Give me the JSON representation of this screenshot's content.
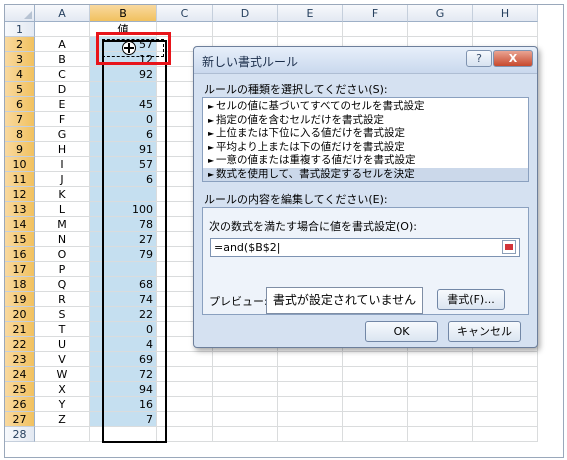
{
  "sheet": {
    "columns": [
      "A",
      "B",
      "C",
      "D",
      "E",
      "F",
      "G",
      "H"
    ],
    "selected_column": "B",
    "rows": [
      {
        "n": "1",
        "a": "",
        "b": "値"
      },
      {
        "n": "2",
        "a": "A",
        "b": "57"
      },
      {
        "n": "3",
        "a": "B",
        "b": "12"
      },
      {
        "n": "4",
        "a": "C",
        "b": "92"
      },
      {
        "n": "5",
        "a": "D",
        "b": ""
      },
      {
        "n": "6",
        "a": "E",
        "b": "45"
      },
      {
        "n": "7",
        "a": "F",
        "b": "0"
      },
      {
        "n": "8",
        "a": "G",
        "b": "6"
      },
      {
        "n": "9",
        "a": "H",
        "b": "91"
      },
      {
        "n": "10",
        "a": "I",
        "b": "57"
      },
      {
        "n": "11",
        "a": "J",
        "b": "6"
      },
      {
        "n": "12",
        "a": "K",
        "b": ""
      },
      {
        "n": "13",
        "a": "L",
        "b": "100"
      },
      {
        "n": "14",
        "a": "M",
        "b": "78"
      },
      {
        "n": "15",
        "a": "N",
        "b": "27"
      },
      {
        "n": "16",
        "a": "O",
        "b": "79"
      },
      {
        "n": "17",
        "a": "P",
        "b": ""
      },
      {
        "n": "18",
        "a": "Q",
        "b": "68"
      },
      {
        "n": "19",
        "a": "R",
        "b": "74"
      },
      {
        "n": "20",
        "a": "S",
        "b": "22"
      },
      {
        "n": "21",
        "a": "T",
        "b": "0"
      },
      {
        "n": "22",
        "a": "U",
        "b": "4"
      },
      {
        "n": "23",
        "a": "V",
        "b": "69"
      },
      {
        "n": "24",
        "a": "W",
        "b": "72"
      },
      {
        "n": "25",
        "a": "X",
        "b": "94"
      },
      {
        "n": "26",
        "a": "Y",
        "b": "16"
      },
      {
        "n": "27",
        "a": "Z",
        "b": "7"
      },
      {
        "n": "28",
        "a": "",
        "b": ""
      }
    ]
  },
  "dialog": {
    "title": "新しい書式ルール",
    "help_label": "?",
    "close_label": "X",
    "rule_type_label": "ルールの種類を選択してください(S):",
    "rule_types": [
      "セルの値に基づいてすべてのセルを書式設定",
      "指定の値を含むセルだけを書式設定",
      "上位または下位に入る値だけを書式設定",
      "平均より上または下の値だけを書式設定",
      "一意の値または重複する値だけを書式設定",
      "数式を使用して、書式設定するセルを決定"
    ],
    "selected_rule_index": 5,
    "edit_label": "ルールの内容を編集してください(E):",
    "formula_label": "次の数式を満たす場合に値を書式設定(O):",
    "formula_value": "=and($B$2|",
    "preview_label": "プレビュー:",
    "preview_text": "書式が設定されていません",
    "format_button": "書式(F)...",
    "ok_button": "OK",
    "cancel_button": "キャンセル"
  },
  "colors": {
    "selection_fill": "#c5dff0",
    "highlight_border": "#e8141a",
    "dialog_bg": "#d5e1f1"
  }
}
